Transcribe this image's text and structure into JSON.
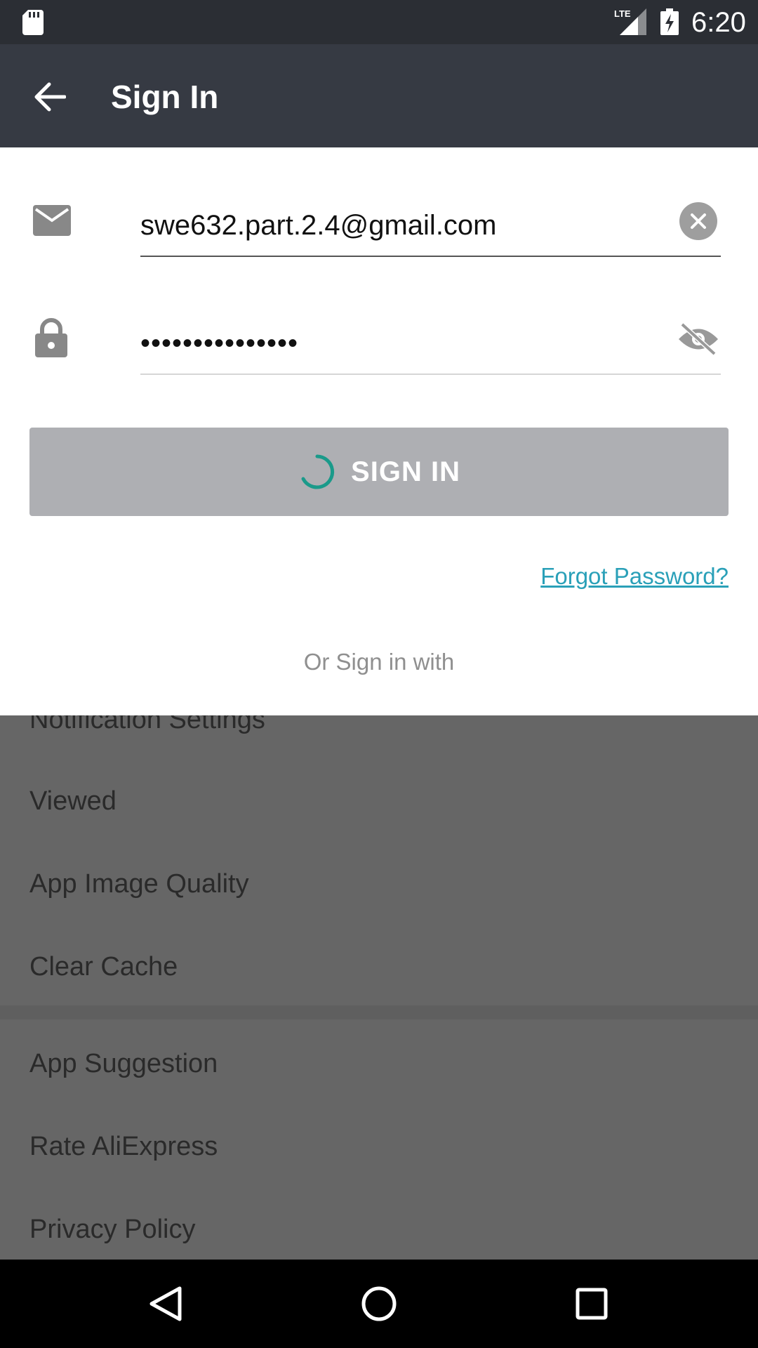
{
  "status_bar": {
    "time": "6:20",
    "network": "LTE"
  },
  "app_bar": {
    "title": "Sign In"
  },
  "form": {
    "email_value": "swe632.part.2.4@gmail.com",
    "password_value": "•••••••••••••••",
    "signin_label": "SIGN IN",
    "forgot_password": "Forgot Password?",
    "or_sign_in_with": "Or Sign in with"
  },
  "settings": {
    "items": [
      "Notification Settings",
      "Viewed",
      "App Image Quality",
      "Clear Cache",
      "App Suggestion",
      "Rate AliExpress",
      "Privacy Policy"
    ]
  },
  "colors": {
    "app_bar": "#363a43",
    "status_bar": "#2b2e34",
    "accent": "#2aa0b8",
    "spinner": "#1a9a8a",
    "button_disabled": "#aeafb3",
    "overlay": "#666666"
  },
  "icons": {
    "back": "arrow-left-icon",
    "mail": "mail-icon",
    "lock": "lock-icon",
    "clear": "close-circle-icon",
    "visibility": "eye-off-icon"
  }
}
